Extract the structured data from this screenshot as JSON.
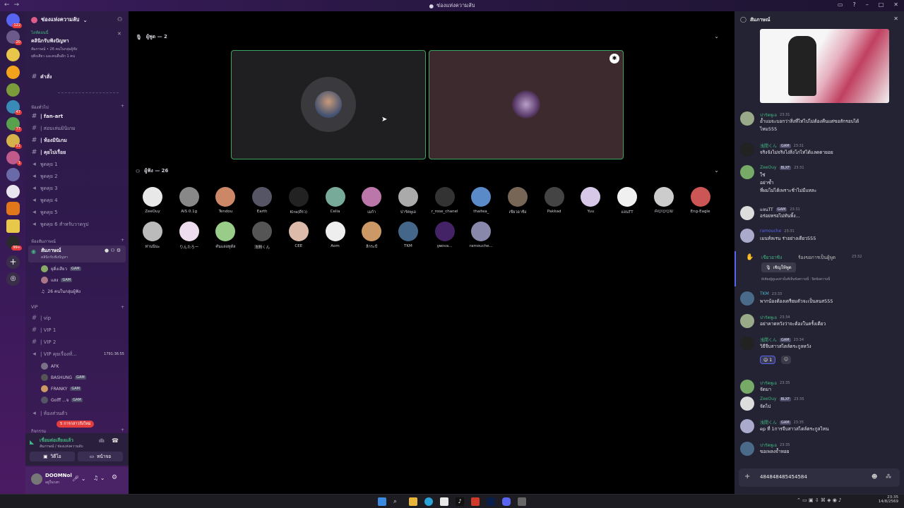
{
  "window": {
    "title": "ช่องแห่งความลับ"
  },
  "servers": {
    "badges": [
      "122",
      "20",
      "47",
      "77",
      "21",
      "1",
      "99+"
    ]
  },
  "sidebar": {
    "server_name": "ช่องแห่งความลับ",
    "event": {
      "live_label": "ไลฟ์ตอนนี้",
      "title": "คลินิกรับฟังปัญหา",
      "line1": "สัมภาษณ์ • 26 คนในกลุ่มผู้ฟัง",
      "line2": "ยุติ่งเสียว และคนอื่นอีก 1 คน"
    },
    "top_channel": "คำสั่ง",
    "category1": "ห้องทั่วไป",
    "text_channels": [
      "| fan-art",
      "| สอบเล่นมินิเกม",
      "| ห้องมินิเกม",
      "| คุยไปเรื่อย"
    ],
    "voice_channels": [
      "พูดคุย 1",
      "พูดคุย 2",
      "พูดคุย 3",
      "พูดคุย 4",
      "พูดคุย 5",
      "พูดคุย 6 สำหรับวาดรูป"
    ],
    "category2": "ห้องสัมภาษณ์",
    "stage_channel": "สัมภาษณ์",
    "stage_sub": "คลินิกรับฟังปัญหา",
    "stage_users": [
      "ยุติ่งเสียว",
      "แสง"
    ],
    "stage_users_tag": "GAM",
    "stage_listeners": "26 คนในกลุ่มผู้ฟัง",
    "category3": "VIP",
    "vip_channels": [
      "| vip",
      "| VIP 1",
      "| VIP 2",
      "| VIP คุยเรื่องทั่..."
    ],
    "vip_timer": "1791:36:55",
    "vip_users": [
      "AFK",
      "BASHUNG",
      "FRANKY",
      "Golff ...จ"
    ],
    "private_channel": "| ห้องส่วนตัว",
    "unread_pill": "5 การกล่าวถึงใหม่",
    "category4": "กิจกรรม",
    "voice_status": "เชื่อมต่อเสียงแล้ว",
    "voice_location": "สัมภาษณ์ / ช่องแห่งความลับ",
    "video_btn": "วิดีโอ",
    "screen_btn": "หน้าจอ",
    "user_name": "DOOMNol",
    "user_status": "อยู่ในวงก"
  },
  "stage": {
    "speakers_label": "ผู้พูด — 2",
    "audience_label": "ผู้ฟัง — 26",
    "audience": [
      "ZeeOuy",
      "AIS 0.1g",
      "Tendou",
      "Earth",
      "Kira(ดีรว)",
      "Celia",
      "เมก้า",
      "ปารัคพูเอ",
      "r_rose_chanel",
      "thaitea_",
      "เขียวอาซิง",
      "Pakkad",
      "Yuu",
      "แจนTT",
      "ᗩ☺☺☺ᗯ",
      "Eng-Eagle",
      "ท่านนินะ",
      "りんたろー",
      "คันแลอทูดัล",
      "浅間くん",
      "CEE",
      "Aom",
      "ลีกระบี",
      "TKM",
      "ꜱ͓ɴova...",
      "ramouche..."
    ]
  },
  "chat": {
    "title": "สัมภาษณ์",
    "messages": [
      {
        "user": "ปารัคพูเอ",
        "time": "23:31",
        "lines": [
          "อ้ำแมจะบอกว่าสิ่งที่ไท่ไปไม่ต้องคืนแต่ขอสักรอบได้",
          "ไหม555"
        ],
        "color": "green"
      },
      {
        "user": "浅間くん",
        "tag": "GAM",
        "time": "23:31",
        "lines": [
          "จริงจังไม่จริงไง่สิ่งโภไท่ได้แลดตายอย"
        ],
        "color": "green"
      },
      {
        "user": "ZeeOuy",
        "tag": "BLXF",
        "time": "23:31",
        "lines": [
          "ใช่",
          "อย่าซ้ำ",
          "ที่ผมไม่ได้เพราะช้าไม่มีแหละ"
        ],
        "color": "green"
      },
      {
        "user": "แจนTT",
        "tag": "GAM",
        "time": "23:31",
        "lines": [
          "อร่อยหรอไม่ทันพิ้ง..."
        ],
        "color": "white"
      },
      {
        "user": "ramouche",
        "time": "23:31",
        "lines": [
          "เมนท์ลเรน ร่าอย่างเดียว555"
        ],
        "color": "blue"
      },
      {
        "user": "TKM",
        "time": "23:33",
        "lines": [
          "พากน้องต้องเตรียมตัวจะเป็นลนส555"
        ],
        "color": "cyan"
      },
      {
        "user": "ปารัคพูเอ",
        "time": "23:34",
        "lines": [
          "อย่าคาดหวังว่าจะต้องในครั้งเดียว"
        ],
        "color": "green"
      },
      {
        "user": "浅間くん",
        "tag": "GAM",
        "time": "23:34",
        "lines": [
          "วิธีจีบสาวสไตล์ตระกูลหวัง"
        ],
        "color": "green"
      },
      {
        "user": "ปารัคพูเอ",
        "time": "23:35",
        "lines": [
          "จัดมา"
        ],
        "color": "green"
      },
      {
        "user": "ZeeOuy",
        "tag": "BLXF",
        "time": "23:35",
        "lines": [
          "จัดไป"
        ],
        "color": "green"
      },
      {
        "user": "浅間くん",
        "tag": "GAM",
        "time": "23:35",
        "lines": [
          "ep ที่ 1การจีบสาวสไตล์ตระกูลไหน"
        ],
        "color": "green"
      },
      {
        "user": "ปารัคพูเอ",
        "time": "23:35",
        "lines": [
          "ขอเพลงจ้ำหอย"
        ],
        "color": "green"
      }
    ],
    "request": {
      "user": "เขียวอาซิง",
      "action": "ร้องขอการเป็นผู้พูด",
      "time": "23:32",
      "button": "เชิญให้พูด",
      "note": "มีเพียงผู้ดูแลเท่านั้นที่เห็นข้อความนี้ · ปิดข้อความนี้"
    },
    "reaction_count": "1",
    "input_value": "484848485454584"
  },
  "taskbar": {
    "time": "23:35",
    "date": "14/8/2569"
  }
}
